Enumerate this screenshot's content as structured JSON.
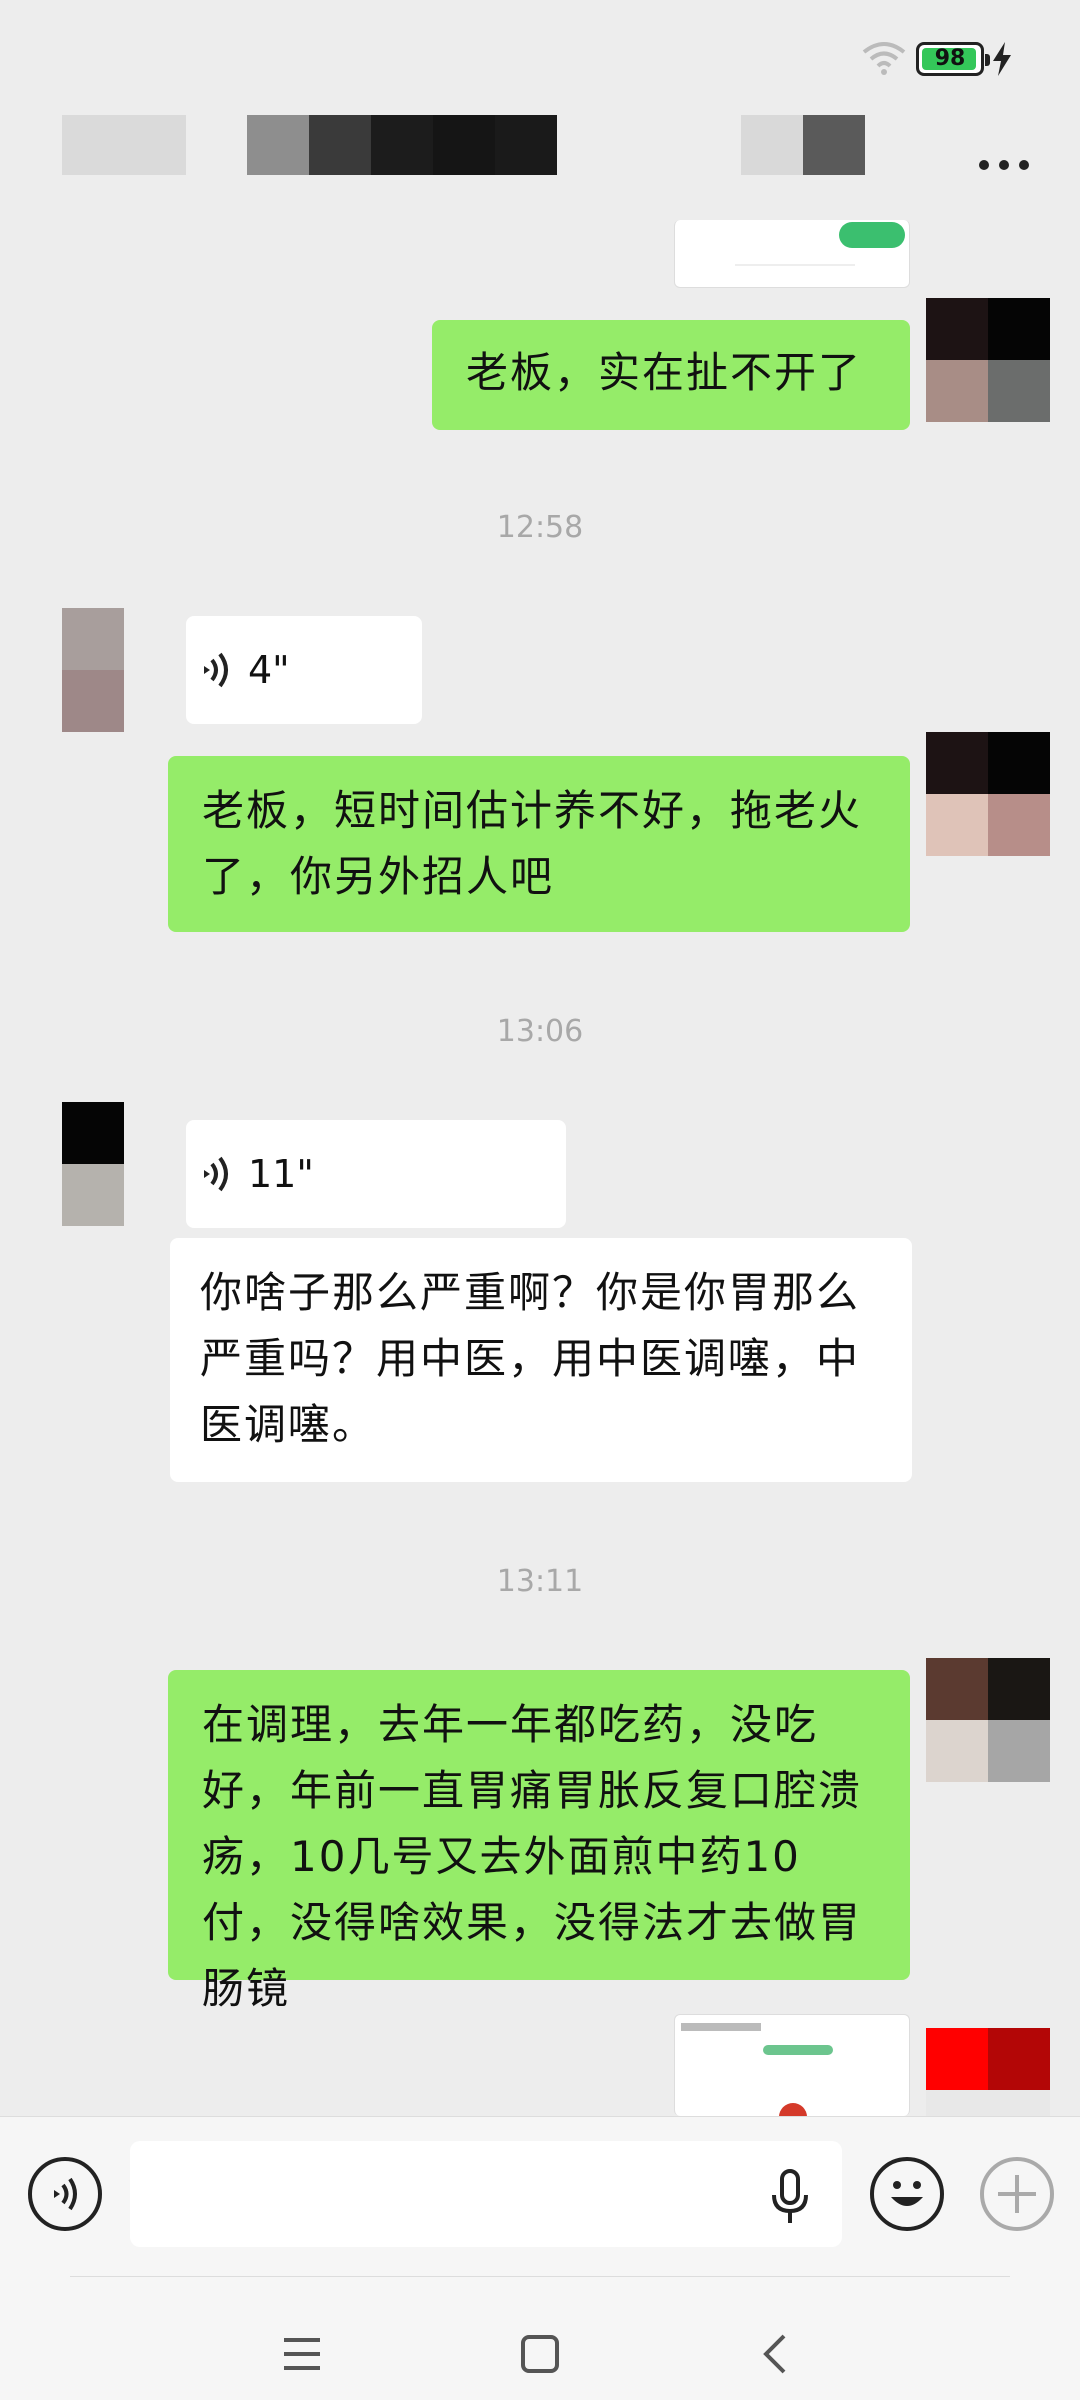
{
  "status_bar": {
    "battery_level": "98"
  },
  "messages": [
    {
      "text": "老板，实在扯不开了"
    },
    {
      "time": "12:58"
    },
    {
      "voice_duration": "4\""
    },
    {
      "text": "老板，短时间估计养不好，拖老火了，你另外招人吧"
    },
    {
      "time": "13:06"
    },
    {
      "voice_duration": "11\""
    },
    {
      "text": "你啥子那么严重啊？你是你胃那么严重吗？用中医，用中医调噻，中医调噻。"
    },
    {
      "time": "13:11"
    },
    {
      "text": "在调理，去年一年都吃药，没吃好，年前一直胃痛胃胀反复口腔溃疡，10几号又去外面煎中药10付，没得啥效果，没得法才去做胃肠镜"
    }
  ],
  "colors": {
    "sent_bubble": "#95ec69",
    "received_bubble": "#ffffff",
    "background": "#ededed"
  },
  "icons": [
    "wifi-icon",
    "battery-icon",
    "charging-icon",
    "more-icon",
    "voice-icon",
    "microphone-icon",
    "emoji-icon",
    "plus-icon",
    "menu-icon",
    "home-icon",
    "back-icon"
  ]
}
